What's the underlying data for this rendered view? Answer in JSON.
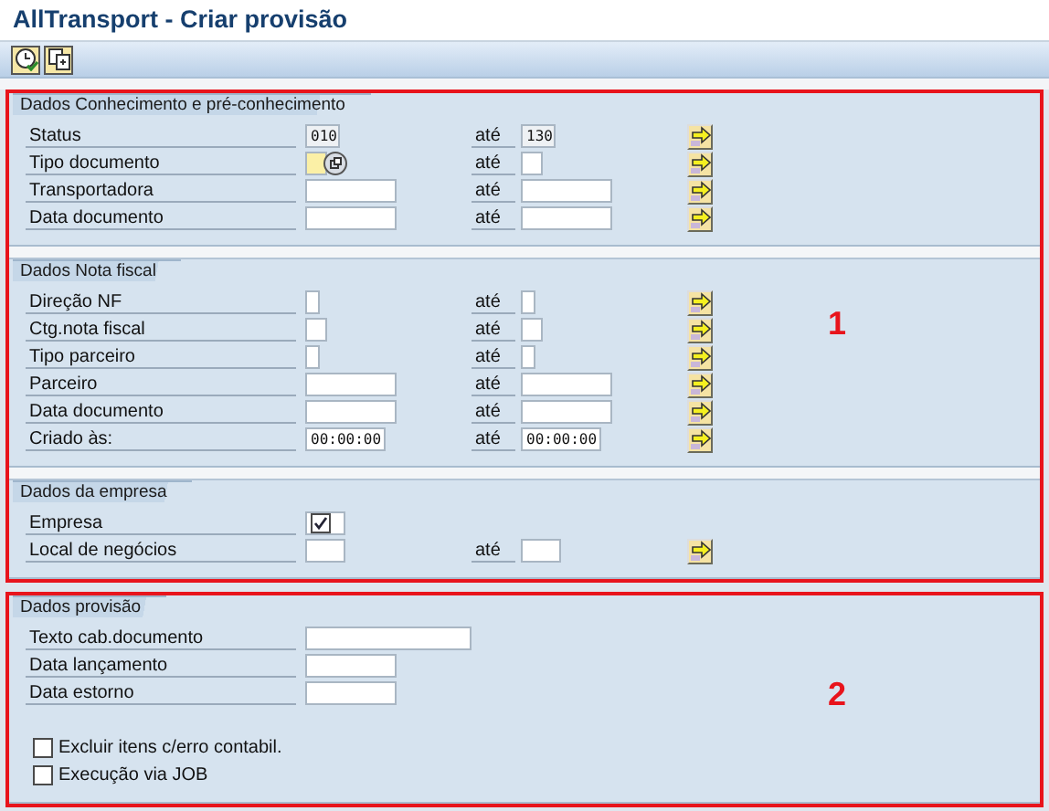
{
  "window": {
    "title": "AllTransport - Criar provisão"
  },
  "sections": [
    {
      "marker": "1",
      "groups": [
        {
          "title": "Dados Conhecimento e pré-conhecimento",
          "rows": [
            {
              "kind": "range",
              "label": "Status",
              "from": {
                "kind": "code",
                "value": "010",
                "readonly": true
              },
              "until": "até",
              "to": {
                "kind": "code",
                "value": "130",
                "readonly": true
              },
              "more": true
            },
            {
              "kind": "range",
              "label": "Tipo documento",
              "from": {
                "kind": "flag2",
                "focused": true,
                "search_help": true
              },
              "until": "até",
              "to": {
                "kind": "flag2"
              },
              "more": true
            },
            {
              "kind": "range",
              "label": "Transportadora",
              "from": {
                "kind": "date"
              },
              "until": "até",
              "to": {
                "kind": "date"
              },
              "more": true
            },
            {
              "kind": "range",
              "label": "Data documento",
              "from": {
                "kind": "date"
              },
              "until": "até",
              "to": {
                "kind": "date"
              },
              "more": true
            }
          ]
        },
        {
          "title": "Dados Nota fiscal",
          "rows": [
            {
              "kind": "range",
              "label": "Direção NF",
              "from": {
                "kind": "flag"
              },
              "until": "até",
              "to": {
                "kind": "flag"
              },
              "more": true
            },
            {
              "kind": "range",
              "label": "Ctg.nota fiscal",
              "from": {
                "kind": "flag2"
              },
              "until": "até",
              "to": {
                "kind": "flag2"
              },
              "more": true
            },
            {
              "kind": "range",
              "label": "Tipo parceiro",
              "from": {
                "kind": "flag"
              },
              "until": "até",
              "to": {
                "kind": "flag"
              },
              "more": true
            },
            {
              "kind": "range",
              "label": "Parceiro",
              "from": {
                "kind": "date"
              },
              "until": "até",
              "to": {
                "kind": "date"
              },
              "more": true
            },
            {
              "kind": "range",
              "label": "Data documento",
              "from": {
                "kind": "date"
              },
              "until": "até",
              "to": {
                "kind": "date"
              },
              "more": true
            },
            {
              "kind": "range",
              "label": "Criado às:",
              "from": {
                "kind": "time",
                "value": "00:00:00"
              },
              "until": "até",
              "to": {
                "kind": "time",
                "value": "00:00:00"
              },
              "more": true
            }
          ]
        },
        {
          "title": "Dados da empresa",
          "rows": [
            {
              "kind": "check",
              "label": "Empresa",
              "checked": true
            },
            {
              "kind": "range",
              "label": "Local de negócios",
              "from": {
                "kind": "code4"
              },
              "until": "até",
              "to": {
                "kind": "code4"
              },
              "more": true
            }
          ]
        }
      ]
    },
    {
      "marker": "2",
      "groups": [
        {
          "title": "Dados provisão",
          "rows": [
            {
              "kind": "single",
              "label": "Texto cab.documento",
              "from": {
                "kind": "text"
              }
            },
            {
              "kind": "single",
              "label": "Data lançamento",
              "from": {
                "kind": "date"
              }
            },
            {
              "kind": "single",
              "label": "Data estorno",
              "from": {
                "kind": "date"
              }
            },
            {
              "kind": "gap"
            },
            {
              "kind": "checkbox",
              "label": "Excluir itens c/erro contabil.",
              "checked": false
            },
            {
              "kind": "checkbox",
              "label": "Execução via JOB",
              "checked": false
            }
          ]
        }
      ]
    }
  ]
}
